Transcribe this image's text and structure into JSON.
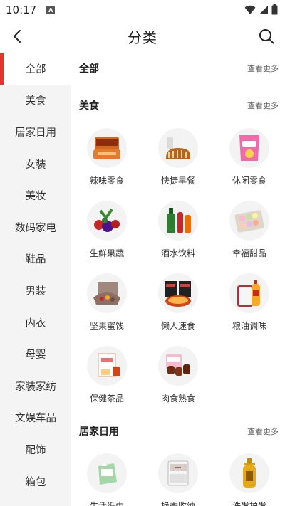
{
  "status": {
    "time": "10:17",
    "app_icon": "A"
  },
  "header": {
    "title": "分类"
  },
  "sidebar": {
    "items": [
      {
        "label": "全部",
        "active": true
      },
      {
        "label": "美食"
      },
      {
        "label": "居家日用"
      },
      {
        "label": "女装"
      },
      {
        "label": "美妆"
      },
      {
        "label": "数码家电"
      },
      {
        "label": "鞋品"
      },
      {
        "label": "男装"
      },
      {
        "label": "内衣"
      },
      {
        "label": "母婴"
      },
      {
        "label": "家装家纺"
      },
      {
        "label": "文娱车品"
      },
      {
        "label": "配饰"
      },
      {
        "label": "箱包"
      }
    ]
  },
  "sections": [
    {
      "title": "全部",
      "more": "查看更多"
    },
    {
      "title": "美食",
      "more": "查看更多",
      "items": [
        {
          "label": "辣味零食",
          "icon": "spicy-snack-icon"
        },
        {
          "label": "快捷早餐",
          "icon": "bread-icon"
        },
        {
          "label": "休闲零食",
          "icon": "chips-icon"
        },
        {
          "label": "生鲜果蔬",
          "icon": "fruit-icon"
        },
        {
          "label": "酒水饮料",
          "icon": "drinks-icon"
        },
        {
          "label": "幸福甜品",
          "icon": "macaron-icon"
        },
        {
          "label": "坚果蜜饯",
          "icon": "nuts-icon"
        },
        {
          "label": "懒人速食",
          "icon": "instant-noodle-icon"
        },
        {
          "label": "粮油调味",
          "icon": "oil-icon"
        },
        {
          "label": "保健茶品",
          "icon": "tea-icon"
        },
        {
          "label": "肉食熟食",
          "icon": "meat-icon"
        }
      ]
    },
    {
      "title": "居家日用",
      "more": "查看更多",
      "items": [
        {
          "label": "生活纸巾",
          "icon": "tissue-icon"
        },
        {
          "label": "换季收纳",
          "icon": "storage-box-icon"
        },
        {
          "label": "洗发护发",
          "icon": "shampoo-icon"
        }
      ]
    }
  ]
}
